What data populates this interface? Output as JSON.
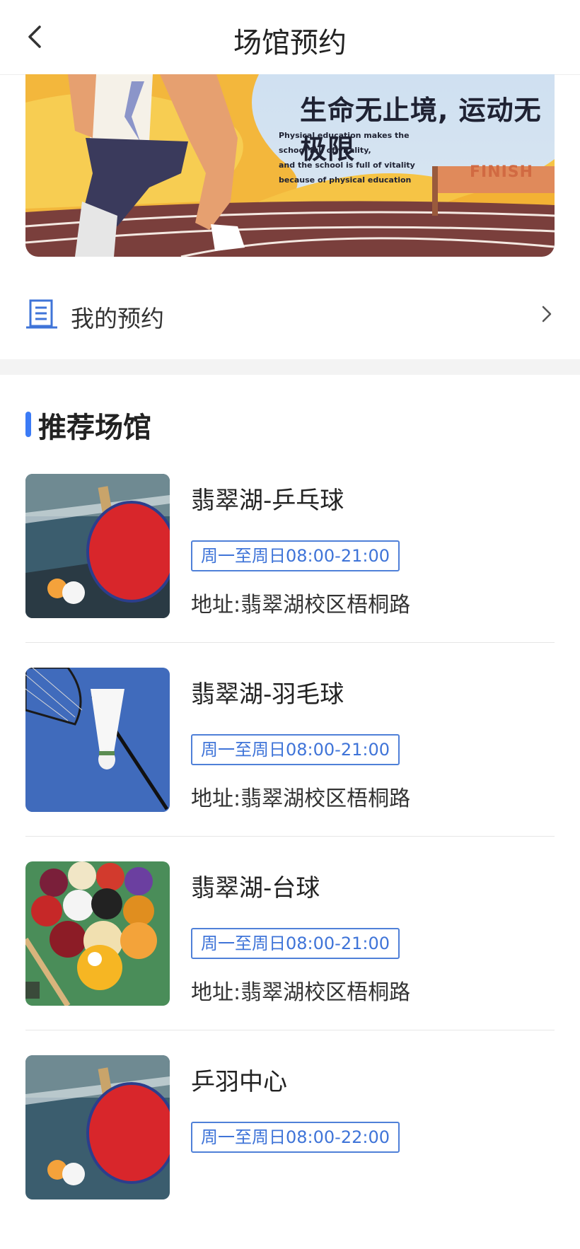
{
  "header": {
    "title": "场馆预约",
    "back_icon": "chevron-left-icon"
  },
  "banner": {
    "headline": "生命无止境, 运动无极限",
    "subtitle_lines": [
      "Physical education makes the",
      "school full of vitality,",
      "and the school is full of vitality",
      "because of physical education"
    ],
    "finish_text": "FINISH"
  },
  "my_reservation": {
    "label": "我的预约",
    "icon": "clipboard-icon",
    "arrow_icon": "chevron-right-icon"
  },
  "recommended": {
    "title": "推荐场馆",
    "venues": [
      {
        "name": "翡翠湖-乒乓球",
        "hours": "周一至周日08:00-21:00",
        "address": "地址:翡翠湖校区梧桐路",
        "image": "table-tennis-image"
      },
      {
        "name": "翡翠湖-羽毛球",
        "hours": "周一至周日08:00-21:00",
        "address": "地址:翡翠湖校区梧桐路",
        "image": "badminton-image"
      },
      {
        "name": "翡翠湖-台球",
        "hours": "周一至周日08:00-21:00",
        "address": "地址:翡翠湖校区梧桐路",
        "image": "billiards-image"
      },
      {
        "name": "乒羽中心",
        "hours": "周一至周日08:00-22:00",
        "address": "",
        "image": "table-tennis-image"
      }
    ]
  }
}
